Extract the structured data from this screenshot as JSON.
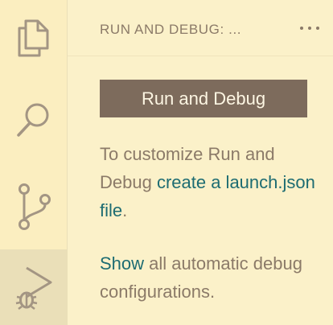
{
  "activity_bar": {
    "items": [
      {
        "name": "explorer",
        "icon": "files-icon",
        "active": false
      },
      {
        "name": "search",
        "icon": "search-icon",
        "active": false
      },
      {
        "name": "source-control",
        "icon": "source-control-icon",
        "active": false
      },
      {
        "name": "run-and-debug",
        "icon": "run-debug-icon",
        "active": true
      }
    ]
  },
  "sidebar": {
    "title": "RUN AND DEBUG: ...",
    "more_actions_icon": "ellipsis-icon",
    "run_button_label": "Run and Debug",
    "customize": {
      "text_before": "To customize Run and Debug ",
      "link": "create a launch.json file",
      "text_after": "."
    },
    "show_all": {
      "link": "Show",
      "text_after": " all automatic debug configurations."
    }
  },
  "colors": {
    "activity_bar_bg": "#fbeec0",
    "sidebar_bg": "#fbf1c9",
    "button_bg": "#7d6b5c",
    "text": "#8b7a68",
    "link": "#1d6c72"
  }
}
